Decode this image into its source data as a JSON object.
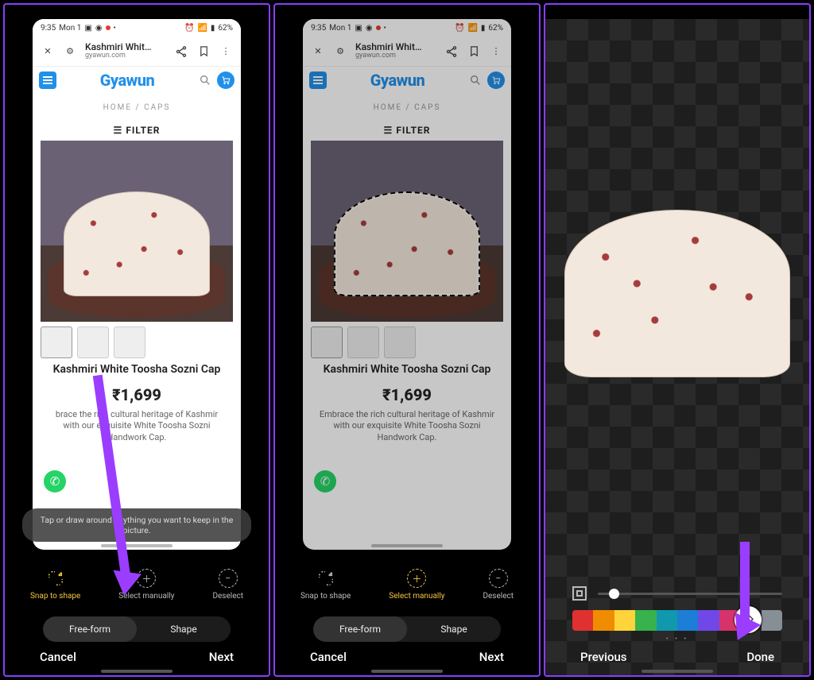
{
  "status": {
    "time": "9:35",
    "day": "Mon 1",
    "battery": "62%"
  },
  "chrome": {
    "title": "Kashmiri Whit…",
    "domain": "gyawun.com"
  },
  "site": {
    "brand": "Gyawun"
  },
  "breadcrumbs": {
    "home": "HOME",
    "sep": "/",
    "cat": "CAPS"
  },
  "filter_label": "FILTER",
  "product": {
    "title": "Kashmiri White Toosha Sozni Cap",
    "price": "₹1,699",
    "desc_full": "Embrace the rich cultural heritage of Kashmir with our exquisite White Toosha Sozni Handwork Cap.",
    "desc_cut": "brace the rich cultural heritage of Kashmir with our exquisite White Toosha Sozni Handwork Cap."
  },
  "editor": {
    "hint": "Tap or draw around anything you want to keep in the picture.",
    "tools": {
      "snap": "Snap to shape",
      "select": "Select manually",
      "deselect": "Deselect"
    },
    "shapes": {
      "free": "Free-form",
      "shape": "Shape"
    },
    "nav": {
      "cancel": "Cancel",
      "next": "Next",
      "previous": "Previous",
      "done": "Done"
    }
  },
  "colors": [
    "#e03131",
    "#f08c00",
    "#ffd43b",
    "#37b24d",
    "#1098ad",
    "#1c7ed6",
    "#7048e8",
    "#d6336c",
    "#212529",
    "#868e96"
  ]
}
